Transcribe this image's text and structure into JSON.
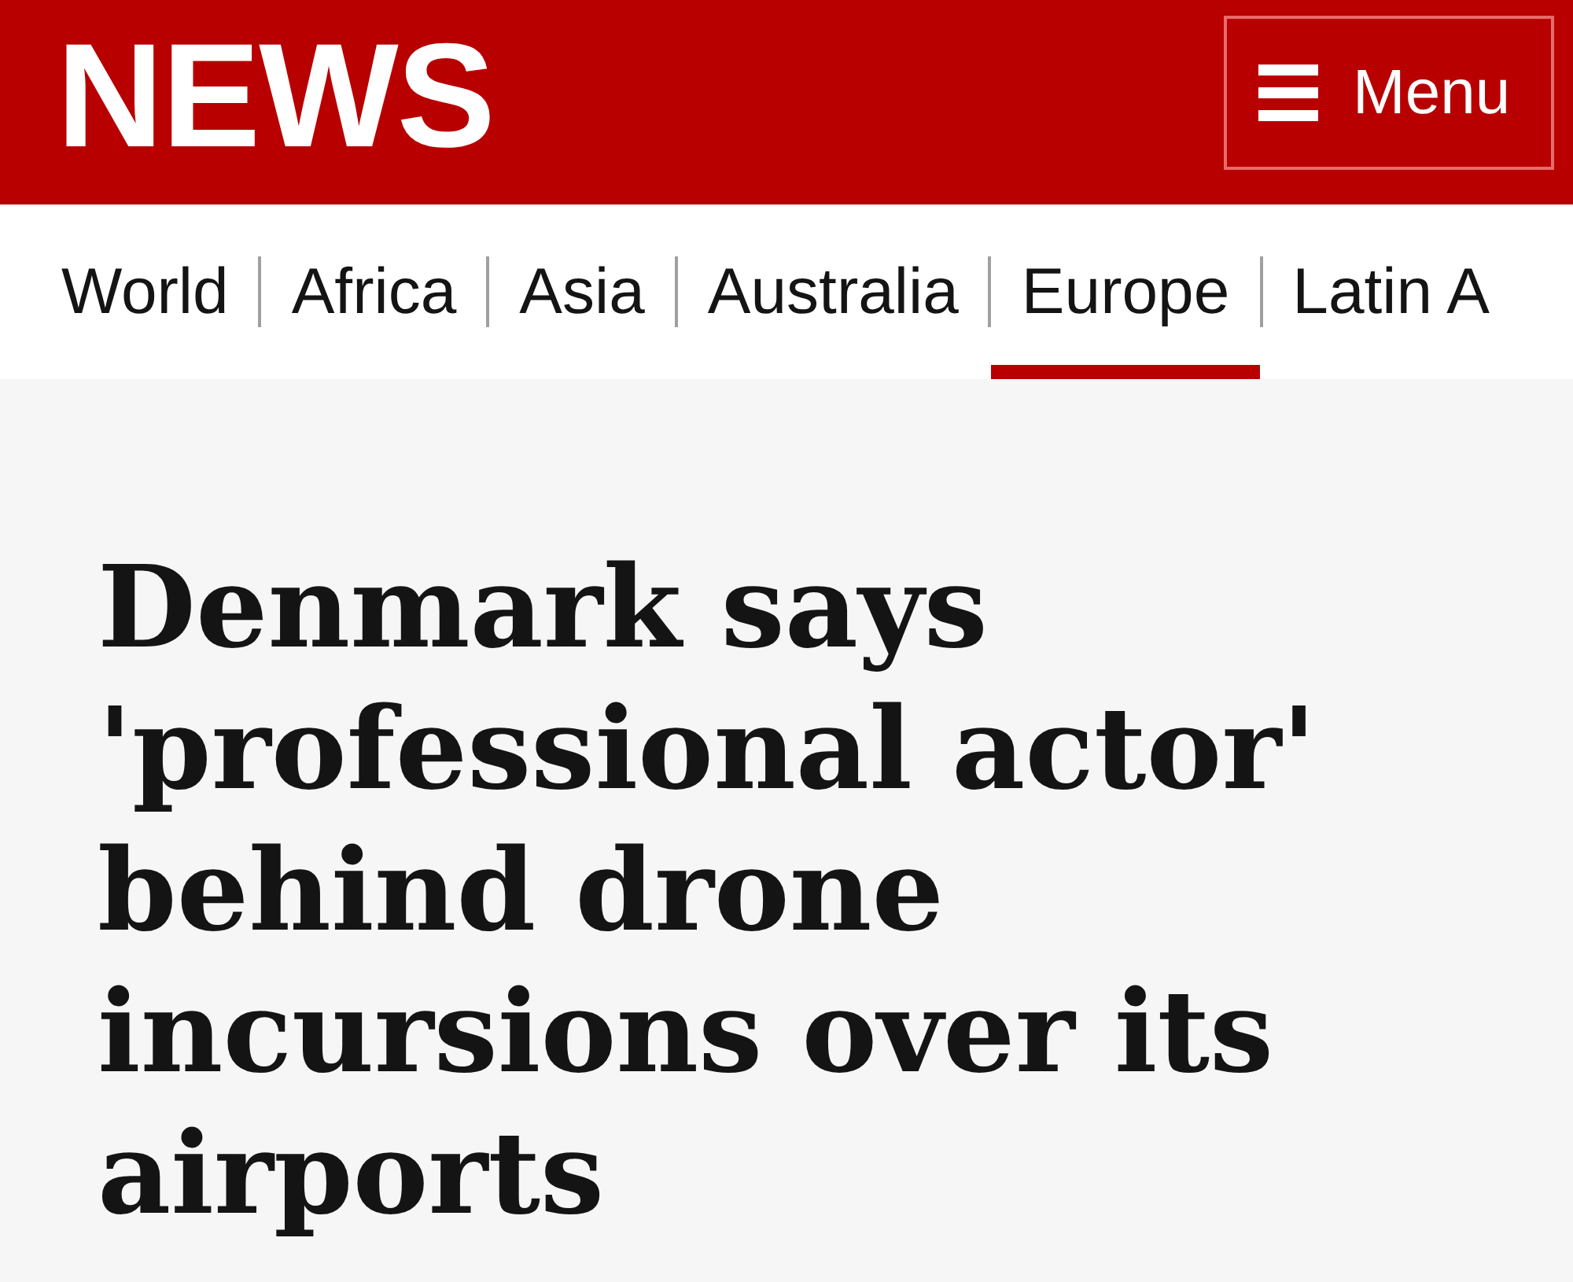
{
  "header": {
    "logo": "NEWS",
    "menu_button": {
      "label": "Menu"
    }
  },
  "nav": {
    "items": [
      {
        "label": "World",
        "selected": false
      },
      {
        "label": "Africa",
        "selected": false
      },
      {
        "label": "Asia",
        "selected": false
      },
      {
        "label": "Australia",
        "selected": false
      },
      {
        "label": "Europe",
        "selected": true
      },
      {
        "label": "Latin A",
        "selected": false
      }
    ]
  },
  "article": {
    "headline": "Denmark says 'professional actor' behind drone incursions over its airports"
  }
}
